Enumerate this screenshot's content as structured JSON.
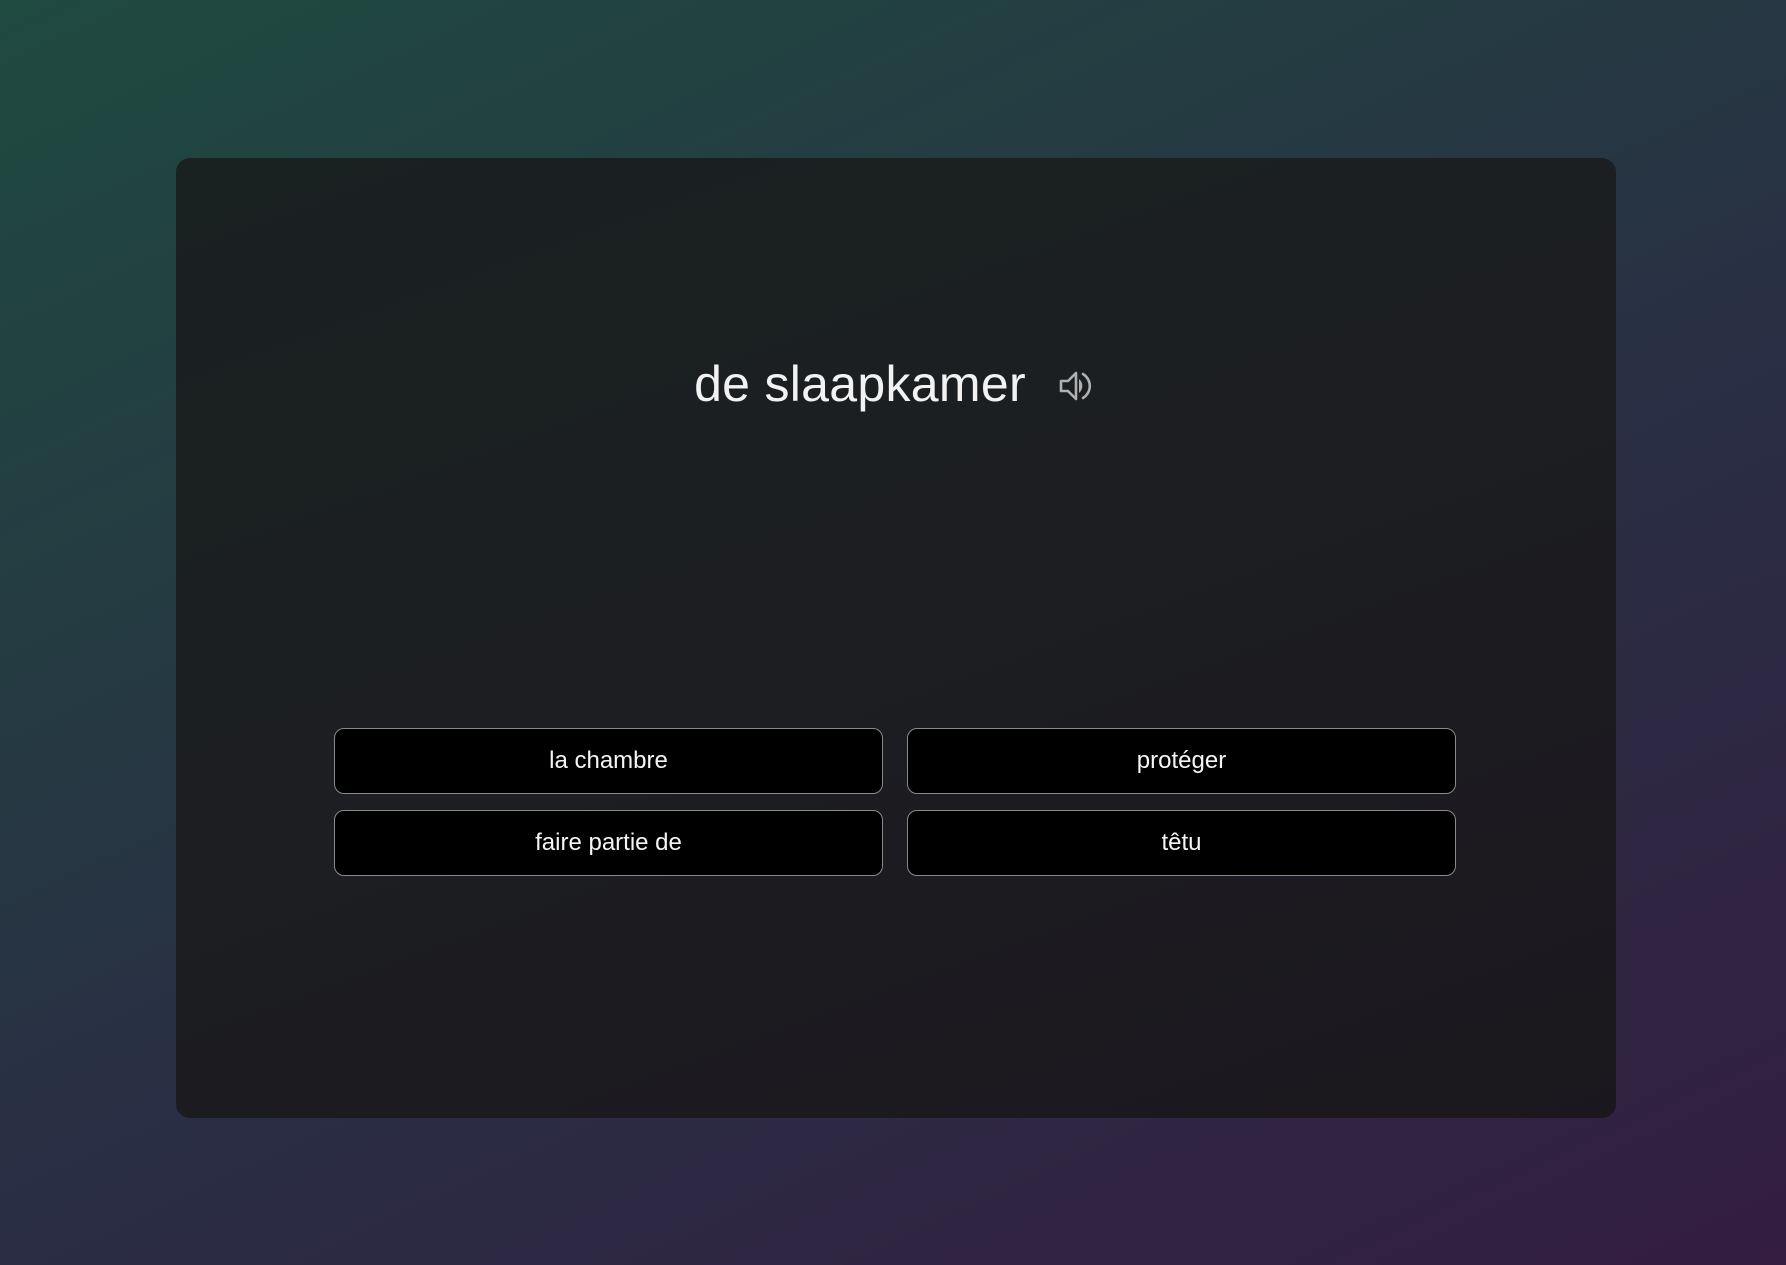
{
  "question": {
    "word": "de slaapkamer",
    "audio_icon": "speaker-icon"
  },
  "answers": [
    {
      "label": "la chambre"
    },
    {
      "label": "protéger"
    },
    {
      "label": "faire partie de"
    },
    {
      "label": "têtu"
    }
  ],
  "colors": {
    "background_start": "#1f4a40",
    "background_end": "#341d40",
    "card": "#1c1e21",
    "option_background": "#000000",
    "option_border": "#8a8a8a",
    "text": "#f2f2f2",
    "icon": "#b0b0b0"
  }
}
